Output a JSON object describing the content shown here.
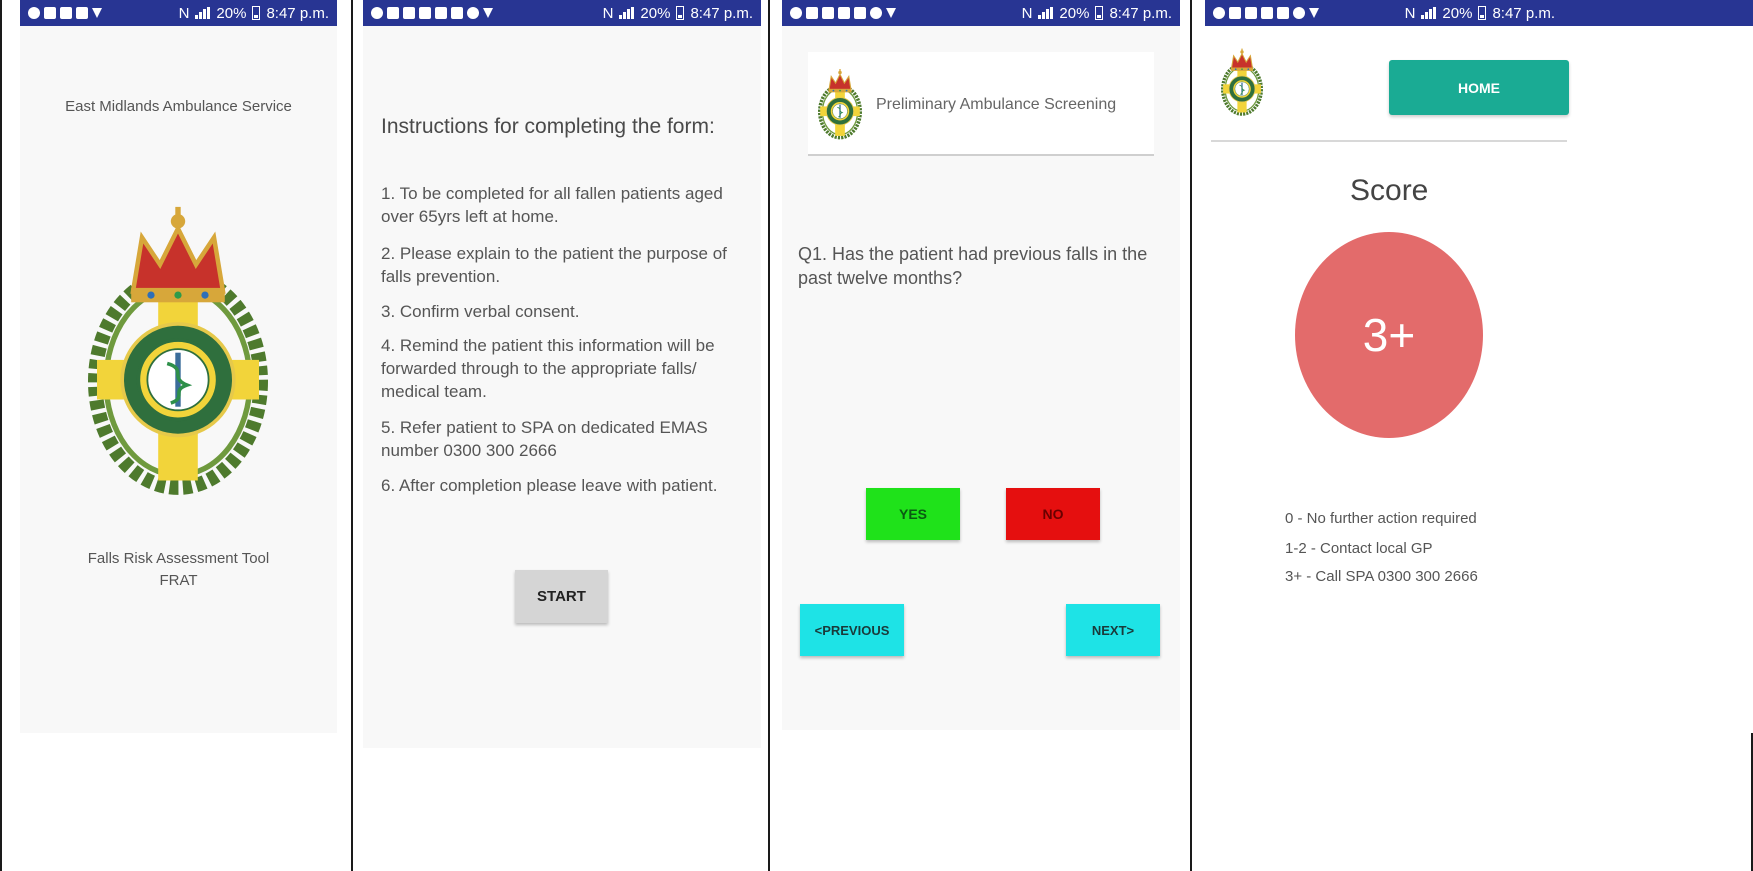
{
  "status_bar": {
    "network": "N",
    "battery": "20%",
    "time": "8:47 p.m."
  },
  "screen1": {
    "org_name": "East Midlands Ambulance Service",
    "tool_name": "Falls Risk Assessment Tool",
    "tool_abbr": "FRAT"
  },
  "screen2": {
    "heading": "Instructions for completing the form:",
    "instructions": [
      "1. To be completed for all fallen patients aged over 65yrs left at home.",
      "2. Please explain to the patient the purpose of falls prevention.",
      "3. Confirm verbal consent.",
      "4. Remind the patient this information will be forwarded through to the appropriate falls/ medical team.",
      "5. Refer patient to SPA on dedicated EMAS number 0300 300 2666",
      "6. After completion please leave with patient."
    ],
    "start_label": "START"
  },
  "screen3": {
    "header_title": "Preliminary Ambulance Screening",
    "question": "Q1. Has the patient had previous falls in the past twelve months?",
    "yes_label": "YES",
    "no_label": "NO",
    "previous_label": "<PREVIOUS",
    "next_label": "NEXT>"
  },
  "screen4": {
    "home_label": "HOME",
    "score_title": "Score",
    "score_value": "3+",
    "legend": [
      "0 - No further action required",
      "1-2 - Contact local GP",
      "3+ - Call SPA 0300 300 2666"
    ]
  },
  "colors": {
    "status_bar": "#283593",
    "yes_button": "#1fe21a",
    "no_button": "#e50f0f",
    "nav_button": "#1ee3e6",
    "home_button": "#1aab94",
    "start_button": "#d5d5d5",
    "score_circle": "#e36b6b"
  },
  "icons": {
    "crest": "ambulance-crest-icon",
    "signal": "signal-icon",
    "battery": "battery-icon",
    "notification": "notification-icon"
  }
}
